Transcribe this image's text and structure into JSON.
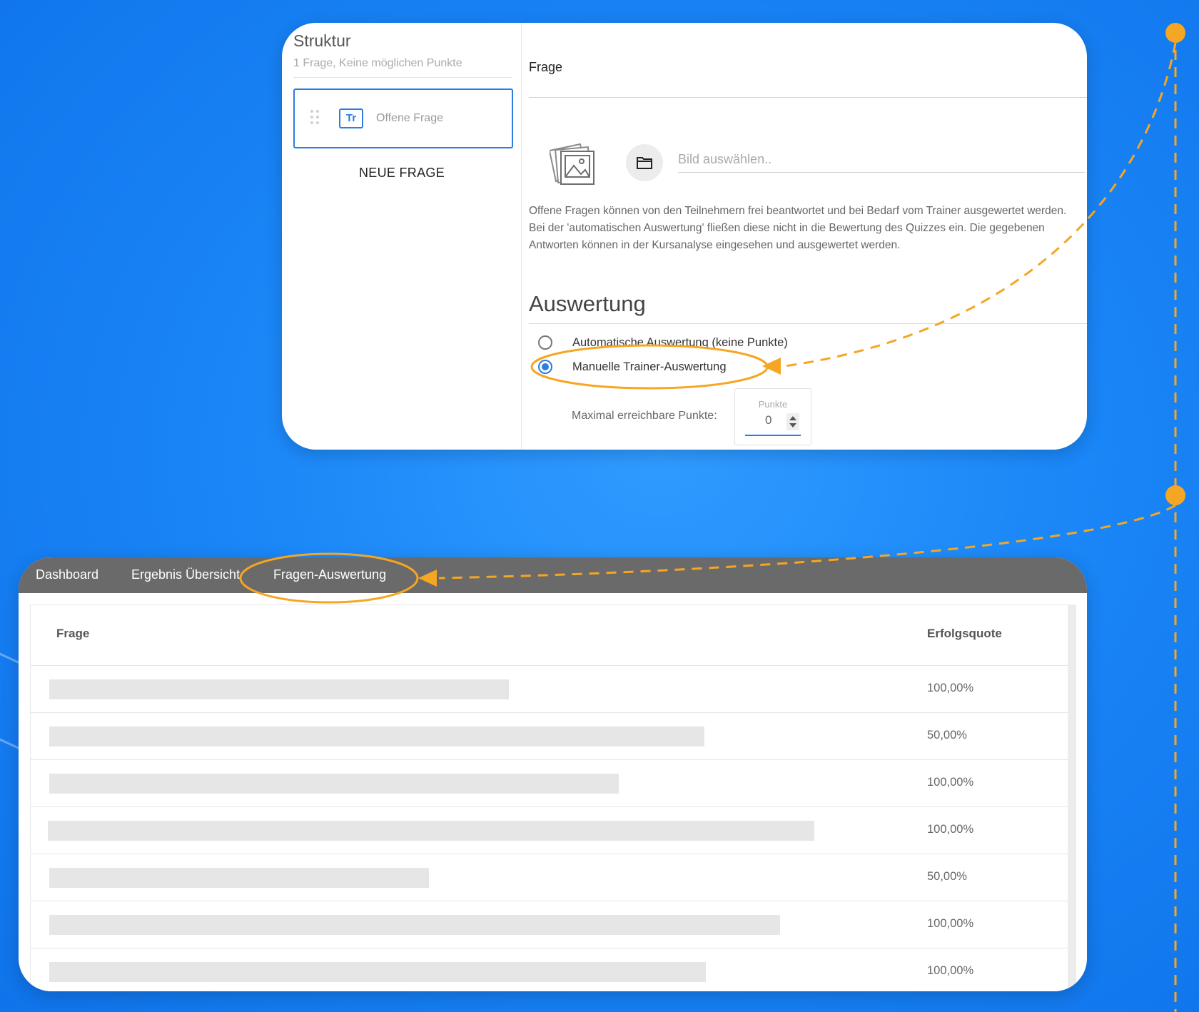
{
  "editor": {
    "structure_title": "Struktur",
    "structure_subtitle": "1 Frage, Keine möglichen Punkte",
    "question_item_label": "Offene Frage",
    "question_item_icon": "Tr",
    "new_question_button": "NEUE FRAGE",
    "question_field_label": "Frage",
    "image_placeholder": "Bild auswählen..",
    "description": "Offene Fragen können von den Teilnehmern frei beantwortet und bei Bedarf vom Trainer ausgewertet werden. Bei der 'automatischen Auswertung' fließen diese nicht in die Bewertung des Quizzes ein. Die gegebenen Antworten können in der Kursanalyse eingesehen und ausgewertet werden.",
    "evaluation_title": "Auswertung",
    "option_auto": "Automatische Auswertung (keine Punkte)",
    "option_manual": "Manuelle Trainer-Auswertung",
    "selected_option": "manual",
    "max_points_label": "Maximal erreichbare Punkte:",
    "points_caption": "Punkte",
    "points_value": "0"
  },
  "analysis": {
    "tabs": [
      {
        "label": "Dashboard"
      },
      {
        "label": "Ergebnis Übersicht"
      },
      {
        "label": "Fragen-Auswertung"
      }
    ],
    "active_tab": "Fragen-Auswertung",
    "columns": {
      "question": "Frage",
      "success": "Erfolgsquote"
    },
    "rows": [
      {
        "rate": "100,00%"
      },
      {
        "rate": "50,00%"
      },
      {
        "rate": "100,00%"
      },
      {
        "rate": "100,00%"
      },
      {
        "rate": "50,00%"
      },
      {
        "rate": "100,00%"
      },
      {
        "rate": "100,00%"
      }
    ]
  },
  "colors": {
    "accent": "#2a7de1",
    "highlight": "#f5a623",
    "background": "#1a86f7",
    "tabbar": "#6a6a6a"
  }
}
